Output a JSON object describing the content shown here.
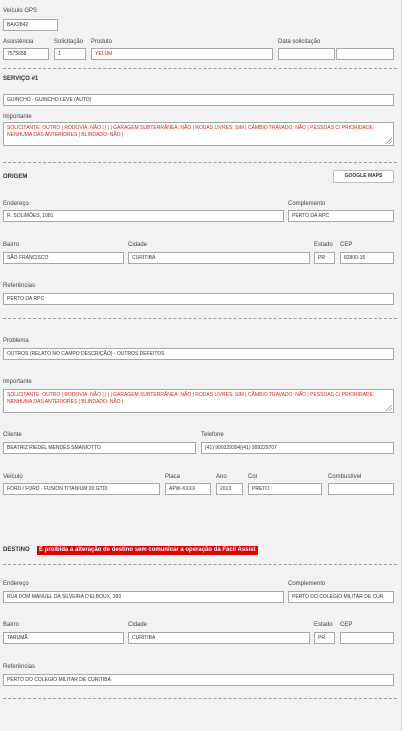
{
  "veiculo_gps": {
    "label": "Veículo GPS",
    "value": "BAX2842"
  },
  "header": {
    "assistencia": {
      "label": "Assistência",
      "value": "7575658"
    },
    "solicitacao": {
      "label": "Solicitação",
      "value": "1"
    },
    "produto": {
      "label": "Produto",
      "value": "YELUM"
    },
    "data_solicitacao": {
      "label": "Data solicitação",
      "value": "",
      "value2": ""
    }
  },
  "servico": {
    "title": "SERVIÇO #1",
    "tipo": "GUINCHO - GUINCHO LEVE (AUTO)",
    "importante_label": "Importante",
    "importante_value": "SOLICITANTE: OUTRO | RODOVIA: NÃO | | | | GARAGEM SUBTERRÂNEA: NÃO | RODAS LIVRES: SIM | CÂMBIO TRAVADO: NÃO | PESSOAS C/ PRIORIDADE: NENHUMA DAS ANTERIORES | BLINDADO: NÃO |"
  },
  "origem": {
    "title": "ORIGEM",
    "maps_button": "GOOGLE MAPS",
    "endereco": {
      "label": "Endereço",
      "value": "R. SOLIMÕES, 1081"
    },
    "complemento": {
      "label": "Complemento",
      "value": "PERTO DA RPC"
    },
    "bairro": {
      "label": "Bairro",
      "value": "SÃO FRANCISCO"
    },
    "cidade": {
      "label": "Cidade",
      "value": "CURITIBA"
    },
    "estado": {
      "label": "Estado",
      "value": "PR"
    },
    "cep": {
      "label": "CEP",
      "value": "82800-16"
    },
    "referencias": {
      "label": "Referências",
      "value": "PERTO DA RPC"
    }
  },
  "problema": {
    "label": "Problema",
    "value": "OUTROS (RELATO NO CAMPO DESCRIÇÃO) - OUTROS DEFEITOS"
  },
  "importante2": {
    "label": "Importante",
    "value": "SOLICITANTE: OUTRO | RODOVIA: NÃO | | | | GARAGEM SUBTERRÂNEA: NÃO | RODAS LIVRES: SIM | CÂMBIO TRAVADO: NÃO | PESSOAS C/ PRIORIDADE: NENHUMA DAS ANTERIORES | BLINDADO: NÃO |"
  },
  "cliente": {
    "label": "Cliente",
    "value": "BEATRIZ RIEDEL MENDES SMANIOTTO"
  },
  "telefone": {
    "label": "Telefone",
    "value": "(41) 999229394|(41) 999229707"
  },
  "veiculo": {
    "veiculo": {
      "label": "Veículo",
      "value": "FORD / FORD - FUSION TITANIUM 20 GTDI"
    },
    "placa": {
      "label": "Placa",
      "value": "APW-XXXX"
    },
    "ano": {
      "label": "Ano",
      "value": "2013"
    },
    "cor": {
      "label": "Cor",
      "value": "PRETO"
    },
    "combustivel": {
      "label": "Combustível",
      "value": ""
    }
  },
  "destino": {
    "title": "DESTINO",
    "warning": "É proibida a alteração de destino sem comunicar a operação da Fácil Assist",
    "endereco": {
      "label": "Endereço",
      "value": "RUA DOM MANUEL DA SILVEIRA D'ELBOUX, 399"
    },
    "complemento": {
      "label": "Complemento",
      "value": "PERTO DO COLEGIO MILITAR DE CUR"
    },
    "bairro": {
      "label": "Bairro",
      "value": "TARUMÃ"
    },
    "cidade": {
      "label": "Cidade",
      "value": "CURITIBA"
    },
    "estado": {
      "label": "Estado",
      "value": "PR"
    },
    "cep": {
      "label": "CEP",
      "value": ""
    },
    "referencias": {
      "label": "Referências",
      "value": "PERTO DO COLEGIO MILITAR DE CURITIBA"
    }
  }
}
